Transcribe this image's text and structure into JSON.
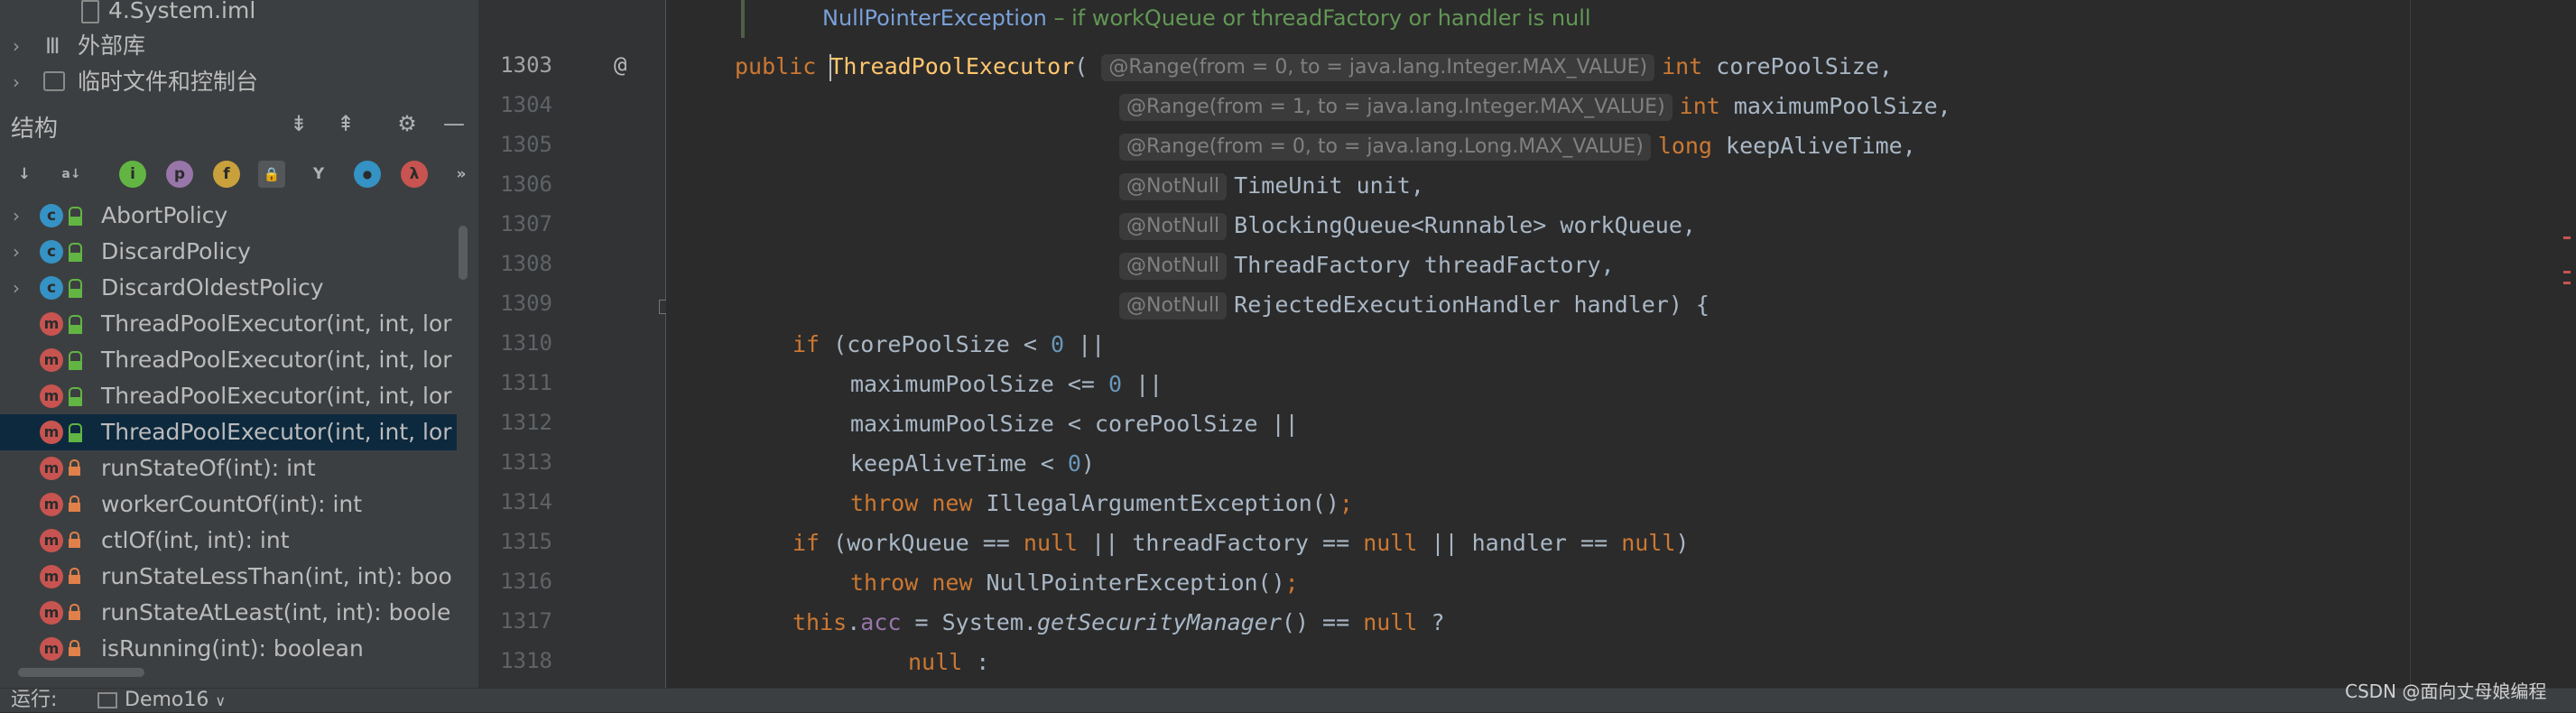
{
  "project": {
    "rows": [
      {
        "label": "4.System.iml",
        "icon": "file-icon",
        "expandable": false
      },
      {
        "label": "外部库",
        "icon": "library-icon",
        "expandable": true
      },
      {
        "label": "临时文件和控制台",
        "icon": "scratch-icon",
        "expandable": true
      }
    ]
  },
  "structure": {
    "title": "结构",
    "header_icons": [
      "expand-all-icon",
      "collapse-all-icon",
      "gear-icon",
      "minimize-icon"
    ],
    "toolbar_icons": [
      {
        "name": "sort-visibility-icon",
        "glyph": "↓"
      },
      {
        "name": "sort-alpha-icon",
        "glyph": "a↓"
      },
      {
        "name": "show-inherited-icon",
        "glyph": "i"
      },
      {
        "name": "show-properties-icon",
        "glyph": "p"
      },
      {
        "name": "show-fields-icon",
        "glyph": "f"
      },
      {
        "name": "show-non-public-icon",
        "glyph": "🔒"
      },
      {
        "name": "show-hierarchy-icon",
        "glyph": "Y"
      },
      {
        "name": "show-anonymous-icon",
        "glyph": "●"
      },
      {
        "name": "show-lambdas-icon",
        "glyph": "λ"
      },
      {
        "name": "more-icon",
        "glyph": "»"
      }
    ],
    "items": [
      {
        "label": "AbortPolicy",
        "kind": "class",
        "visibility": "public",
        "expandable": true
      },
      {
        "label": "DiscardPolicy",
        "kind": "class",
        "visibility": "public",
        "expandable": true
      },
      {
        "label": "DiscardOldestPolicy",
        "kind": "class",
        "visibility": "public",
        "expandable": true
      },
      {
        "label": "ThreadPoolExecutor(int, int, lor",
        "kind": "method",
        "visibility": "public"
      },
      {
        "label": "ThreadPoolExecutor(int, int, lor",
        "kind": "method",
        "visibility": "public"
      },
      {
        "label": "ThreadPoolExecutor(int, int, lor",
        "kind": "method",
        "visibility": "public"
      },
      {
        "label": "ThreadPoolExecutor(int, int, lor",
        "kind": "method",
        "visibility": "public",
        "selected": true
      },
      {
        "label": "runStateOf(int): int",
        "kind": "method",
        "visibility": "private"
      },
      {
        "label": "workerCountOf(int): int",
        "kind": "method",
        "visibility": "private"
      },
      {
        "label": "ctlOf(int, int): int",
        "kind": "method",
        "visibility": "private"
      },
      {
        "label": "runStateLessThan(int, int): boo",
        "kind": "method",
        "visibility": "private"
      },
      {
        "label": "runStateAtLeast(int, int): boole",
        "kind": "method",
        "visibility": "private"
      },
      {
        "label": "isRunning(int): boolean",
        "kind": "method",
        "visibility": "private"
      }
    ]
  },
  "editor": {
    "doc_line": {
      "code": "NullPointerException",
      "text": " – if workQueue or threadFactory or handler is null"
    },
    "bookmark": "@",
    "line_numbers": [
      "1303",
      "1304",
      "1305",
      "1306",
      "1307",
      "1308",
      "1309",
      "1310",
      "1311",
      "1312",
      "1313",
      "1314",
      "1315",
      "1316",
      "1317",
      "1318"
    ],
    "current_line_index": 0,
    "hints": [
      "@Range(from = 0, to = java.lang.Integer.MAX_VALUE)",
      "@Range(from = 1, to = java.lang.Integer.MAX_VALUE)",
      "@Range(from = 0, to = java.lang.Long.MAX_VALUE)",
      "@NotNull",
      "@NotNull",
      "@NotNull",
      "@NotNull"
    ],
    "code": {
      "l1303": {
        "kw": "public ",
        "fn": "ThreadPoolExecutor",
        "open": "(",
        "type": "int",
        "rest": " corePoolSize,"
      },
      "l1304": {
        "type": "int",
        "rest": " maximumPoolSize,"
      },
      "l1305": {
        "type": "long",
        "rest": " keepAliveTime,"
      },
      "l1306": {
        "rest": "TimeUnit unit,"
      },
      "l1307": {
        "rest": "BlockingQueue<Runnable> workQueue,"
      },
      "l1308": {
        "rest": "ThreadFactory threadFactory,"
      },
      "l1309": {
        "rest": "RejectedExecutionHandler handler) {"
      },
      "l1310": {
        "kw": "if",
        "a": " (corePoolSize < ",
        "num": "0",
        "b": " ||"
      },
      "l1311": {
        "a": "maximumPoolSize <= ",
        "num": "0",
        "b": " ||"
      },
      "l1312": {
        "a": "maximumPoolSize < corePoolSize ||"
      },
      "l1313": {
        "a": "keepAliveTime < ",
        "num": "0",
        "b": ")"
      },
      "l1314": {
        "kw1": "throw ",
        "kw2": "new ",
        "a": "IllegalArgumentException()",
        "semi": ";"
      },
      "l1315": {
        "kw": "if",
        "a": " (workQueue == ",
        "n1": "null",
        "b": " || threadFactory == ",
        "n2": "null",
        "c": " || handler == ",
        "n3": "null",
        "d": ")"
      },
      "l1316": {
        "kw1": "throw ",
        "kw2": "new ",
        "a": "NullPointerException()",
        "semi": ";"
      },
      "l1317": {
        "kw": "this",
        "dot": ".",
        "fld": "acc",
        "a": " = System.",
        "call": "getSecurityManager",
        "b": "() == ",
        "n1": "null",
        "c": " ?"
      },
      "l1318": {
        "n1": "null",
        "c": " :"
      }
    }
  },
  "status": {
    "run_label": "运行:",
    "tab_label": "Demo16"
  },
  "watermark": "CSDN @面向丈母娘编程",
  "colors": {
    "keyword": "#cc7832",
    "function": "#ffc66d",
    "number": "#6897bb",
    "field": "#9876aa",
    "text": "#a9b7c6",
    "selection": "#0d293e"
  }
}
